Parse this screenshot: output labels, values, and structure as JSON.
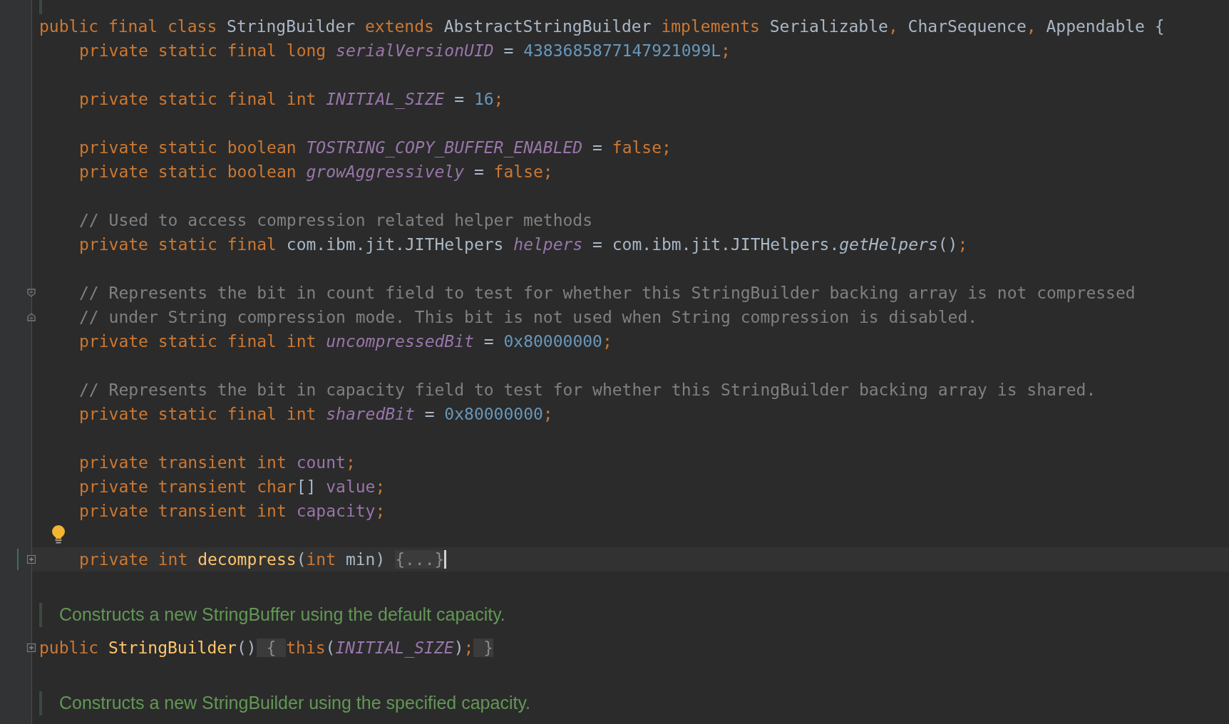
{
  "editor": {
    "lines": [
      {
        "kind": "class_code",
        "tokens": [
          {
            "text": "public final class ",
            "kind": "keyword"
          },
          {
            "text": "StringBuilder ",
            "kind": "plain"
          },
          {
            "text": "extends ",
            "kind": "keyword"
          },
          {
            "text": "AbstractStringBuilder ",
            "kind": "plain"
          },
          {
            "text": "implements ",
            "kind": "keyword"
          },
          {
            "text": "Serializable",
            "kind": "plain"
          },
          {
            "text": ", ",
            "kind": "punct"
          },
          {
            "text": "CharSequence",
            "kind": "plain"
          },
          {
            "text": ", ",
            "kind": "punct"
          },
          {
            "text": "Appendable {",
            "kind": "plain"
          }
        ]
      },
      {
        "kind": "member_code",
        "tokens": [
          {
            "text": "private static final long ",
            "kind": "keyword"
          },
          {
            "text": "serialVersionUID",
            "kind": "static"
          },
          {
            "text": " = ",
            "kind": "plain"
          },
          {
            "text": "4383685877147921099L",
            "kind": "number"
          },
          {
            "text": ";",
            "kind": "punct"
          }
        ]
      },
      {
        "kind": "blank"
      },
      {
        "kind": "member_code",
        "tokens": [
          {
            "text": "private static final int ",
            "kind": "keyword"
          },
          {
            "text": "INITIAL_SIZE",
            "kind": "static"
          },
          {
            "text": " = ",
            "kind": "plain"
          },
          {
            "text": "16",
            "kind": "number"
          },
          {
            "text": ";",
            "kind": "punct"
          }
        ]
      },
      {
        "kind": "blank"
      },
      {
        "kind": "member_code",
        "tokens": [
          {
            "text": "private static boolean ",
            "kind": "keyword"
          },
          {
            "text": "TOSTRING_COPY_BUFFER_ENABLED",
            "kind": "static"
          },
          {
            "text": " = ",
            "kind": "plain"
          },
          {
            "text": "false;",
            "kind": "keyword"
          }
        ]
      },
      {
        "kind": "member_code",
        "tokens": [
          {
            "text": "private static boolean ",
            "kind": "keyword"
          },
          {
            "text": "growAggressively",
            "kind": "static"
          },
          {
            "text": " = ",
            "kind": "plain"
          },
          {
            "text": "false;",
            "kind": "keyword"
          }
        ]
      },
      {
        "kind": "blank"
      },
      {
        "kind": "member_code",
        "tokens": [
          {
            "text": "// Used to access compression related helper methods",
            "kind": "comment"
          }
        ]
      },
      {
        "kind": "member_code",
        "tokens": [
          {
            "text": "private static final ",
            "kind": "keyword"
          },
          {
            "text": "com.ibm.jit.JITHelpers ",
            "kind": "plain"
          },
          {
            "text": "helpers",
            "kind": "static"
          },
          {
            "text": " = com.ibm.jit.JITHelpers.",
            "kind": "plain"
          },
          {
            "text": "getHelpers",
            "kind": "staticcall"
          },
          {
            "text": "()",
            "kind": "plain"
          },
          {
            "text": ";",
            "kind": "punct"
          }
        ]
      },
      {
        "kind": "blank"
      },
      {
        "kind": "member_code",
        "fold_start": true,
        "tokens": [
          {
            "text": "// Represents the bit in count field to test for whether this StringBuilder backing array is not compressed",
            "kind": "comment"
          }
        ]
      },
      {
        "kind": "member_code",
        "fold_end": true,
        "tokens": [
          {
            "text": "// under String compression mode. This bit is not used when String compression is disabled.",
            "kind": "comment"
          }
        ]
      },
      {
        "kind": "member_code",
        "tokens": [
          {
            "text": "private static final int ",
            "kind": "keyword"
          },
          {
            "text": "uncompressedBit",
            "kind": "static"
          },
          {
            "text": " = ",
            "kind": "plain"
          },
          {
            "text": "0x80000000",
            "kind": "number"
          },
          {
            "text": ";",
            "kind": "punct"
          }
        ]
      },
      {
        "kind": "blank"
      },
      {
        "kind": "member_code",
        "tokens": [
          {
            "text": "// Represents the bit in capacity field to test for whether this StringBuilder backing array is shared.",
            "kind": "comment"
          }
        ]
      },
      {
        "kind": "member_code",
        "tokens": [
          {
            "text": "private static final int ",
            "kind": "keyword"
          },
          {
            "text": "sharedBit",
            "kind": "static"
          },
          {
            "text": " = ",
            "kind": "plain"
          },
          {
            "text": "0x80000000",
            "kind": "number"
          },
          {
            "text": ";",
            "kind": "punct"
          }
        ]
      },
      {
        "kind": "blank"
      },
      {
        "kind": "member_code",
        "tokens": [
          {
            "text": "private transient int ",
            "kind": "keyword"
          },
          {
            "text": "count",
            "kind": "field"
          },
          {
            "text": ";",
            "kind": "punct"
          }
        ]
      },
      {
        "kind": "member_code",
        "tokens": [
          {
            "text": "private transient char",
            "kind": "keyword"
          },
          {
            "text": "[] ",
            "kind": "plain"
          },
          {
            "text": "value",
            "kind": "field"
          },
          {
            "text": ";",
            "kind": "punct"
          }
        ]
      },
      {
        "kind": "member_code",
        "tokens": [
          {
            "text": "private transient int ",
            "kind": "keyword"
          },
          {
            "text": "capacity",
            "kind": "field"
          },
          {
            "text": ";",
            "kind": "punct"
          }
        ]
      },
      {
        "kind": "blank",
        "bulb": true
      },
      {
        "kind": "member_code",
        "current": true,
        "changed": true,
        "caret": true,
        "collapsed": true,
        "tokens": [
          {
            "text": "private int ",
            "kind": "keyword"
          },
          {
            "text": "decompress",
            "kind": "method"
          },
          {
            "text": "(",
            "kind": "plain"
          },
          {
            "text": "int ",
            "kind": "keyword"
          },
          {
            "text": "min) ",
            "kind": "plain"
          },
          {
            "text": "{...}",
            "kind": "folded"
          }
        ]
      },
      {
        "kind": "doc",
        "text": "Constructs a new StringBuffer using the default capacity."
      },
      {
        "kind": "class_code",
        "collapsed": true,
        "tokens": [
          {
            "text": "public ",
            "kind": "keyword"
          },
          {
            "text": "StringBuilder",
            "kind": "method"
          },
          {
            "text": "()",
            "kind": "plain"
          },
          {
            "text": " { ",
            "kind": "folded"
          },
          {
            "text": "this",
            "kind": "keyword"
          },
          {
            "text": "(",
            "kind": "plain"
          },
          {
            "text": "INITIAL_SIZE",
            "kind": "static"
          },
          {
            "text": ")",
            "kind": "plain"
          },
          {
            "text": ";",
            "kind": "punct"
          },
          {
            "text": " }",
            "kind": "folded"
          }
        ]
      },
      {
        "kind": "doc",
        "text": "Constructs a new StringBuilder using the specified capacity."
      }
    ]
  }
}
